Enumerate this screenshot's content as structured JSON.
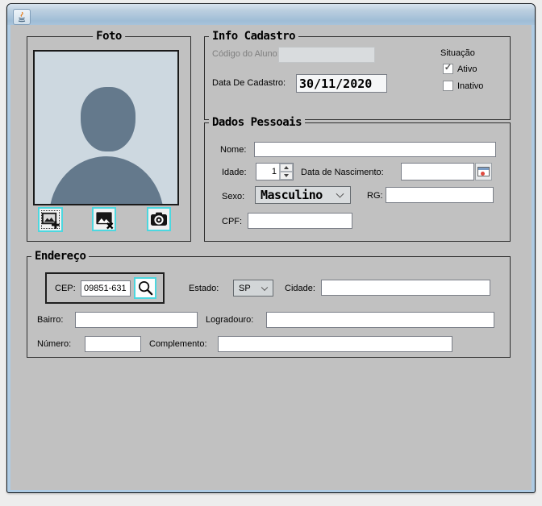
{
  "window": {
    "title": ""
  },
  "foto": {
    "title": "Foto",
    "buttons": [
      {
        "name": "add-photo"
      },
      {
        "name": "remove-photo"
      },
      {
        "name": "take-photo"
      }
    ]
  },
  "info": {
    "title": "Info Cadastro",
    "codigo_label": "Código do Aluno:",
    "codigo_value": "",
    "data_label": "Data De Cadastro:",
    "data_value": "30/11/2020",
    "situacao_label": "Situação",
    "ativo_label": "Ativo",
    "ativo_checked": true,
    "inativo_label": "Inativo",
    "inativo_checked": false
  },
  "dados": {
    "title": "Dados Pessoais",
    "nome_label": "Nome:",
    "nome_value": "",
    "idade_label": "Idade:",
    "idade_value": "1",
    "nascimento_label": "Data de Nascimento:",
    "nascimento_value": "",
    "sexo_label": "Sexo:",
    "sexo_value": "Masculino",
    "rg_label": "RG:",
    "rg_value": "",
    "cpf_label": "CPF:",
    "cpf_value": ""
  },
  "endereco": {
    "title": "Endereço",
    "cep_label": "CEP:",
    "cep_value": "09851-631",
    "estado_label": "Estado:",
    "estado_value": "SP",
    "cidade_label": "Cidade:",
    "cidade_value": "",
    "bairro_label": "Bairro:",
    "bairro_value": "",
    "logradouro_label": "Logradouro:",
    "logradouro_value": "",
    "numero_label": "Número:",
    "numero_value": "",
    "complemento_label": "Complemento:",
    "complemento_value": ""
  },
  "icons": {
    "check": "✓"
  },
  "colors": {
    "accent_cyan": "#4cd7df",
    "titlebar_top": "#d7e3ee",
    "titlebar_bottom": "#9fbdd6",
    "content_bg": "#c1c1c1",
    "photo_bg": "#cdd8e0",
    "silhouette": "#64798c",
    "disabled_field": "#d9dcde"
  }
}
